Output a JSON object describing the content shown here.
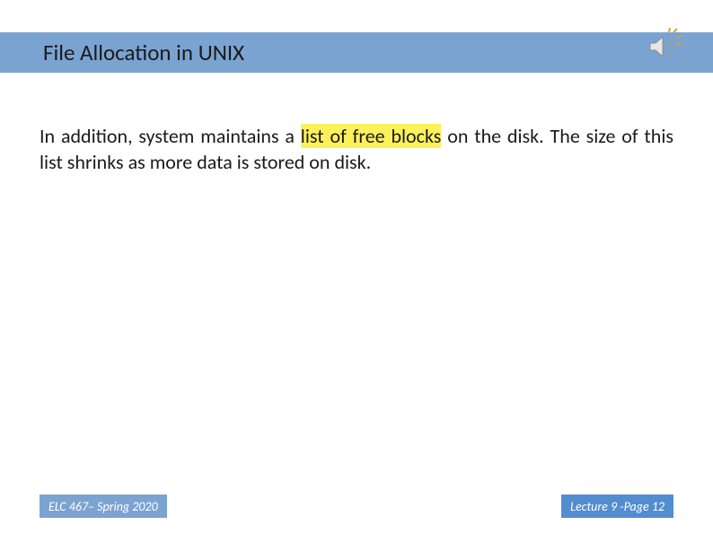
{
  "header": {
    "title": "File Allocation in UNIX"
  },
  "body": {
    "text_before": "In addition, system maintains a ",
    "highlight": "list of free blocks",
    "text_after": " on the disk.  The size of this list shrinks as more data is stored on disk."
  },
  "footer": {
    "left": "ELC 467– Spring 2020",
    "right": "Lecture 9 -Page 12"
  },
  "icons": {
    "speaker": "speaker-icon"
  }
}
